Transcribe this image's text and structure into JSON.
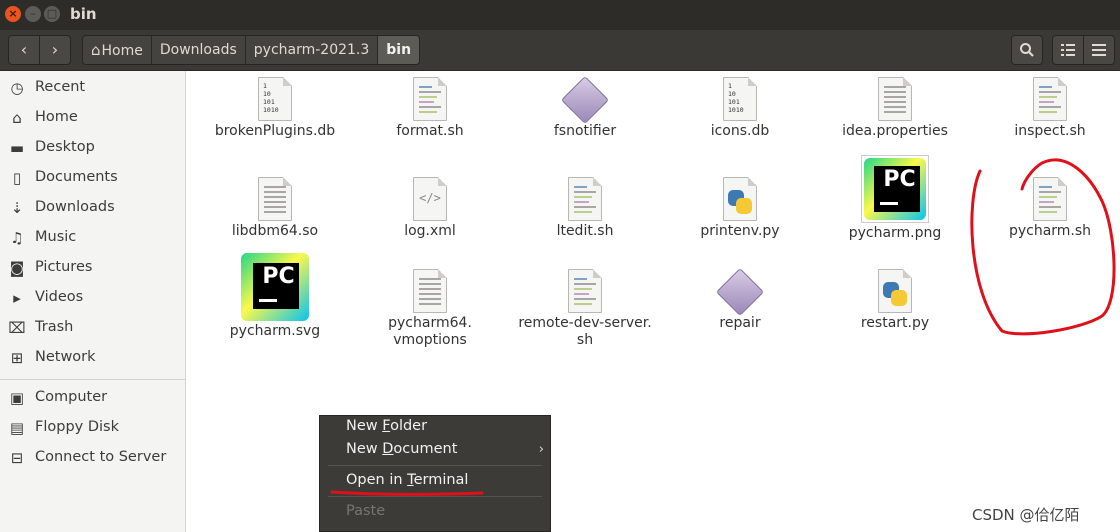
{
  "window": {
    "title": "bin"
  },
  "toolbar": {
    "crumbs": [
      "Home",
      "Downloads",
      "pycharm-2021.3",
      "bin"
    ]
  },
  "sidebar": {
    "items": [
      {
        "label": "Recent",
        "icon": "clock-icon"
      },
      {
        "label": "Home",
        "icon": "home-icon"
      },
      {
        "label": "Desktop",
        "icon": "folder-icon"
      },
      {
        "label": "Documents",
        "icon": "document-icon"
      },
      {
        "label": "Downloads",
        "icon": "download-icon"
      },
      {
        "label": "Music",
        "icon": "music-icon"
      },
      {
        "label": "Pictures",
        "icon": "camera-icon"
      },
      {
        "label": "Videos",
        "icon": "video-icon"
      },
      {
        "label": "Trash",
        "icon": "trash-icon"
      },
      {
        "label": "Network",
        "icon": "network-icon"
      }
    ],
    "devices": [
      {
        "label": "Computer",
        "icon": "computer-icon"
      },
      {
        "label": "Floppy Disk",
        "icon": "floppy-icon"
      },
      {
        "label": "Connect to Server",
        "icon": "server-icon"
      }
    ]
  },
  "files": [
    {
      "name": "brokenPlugins.db",
      "icon": "binary-file-icon"
    },
    {
      "name": "format.sh",
      "icon": "script-file-icon"
    },
    {
      "name": "fsnotifier",
      "icon": "executable-icon"
    },
    {
      "name": "icons.db",
      "icon": "binary-file-icon"
    },
    {
      "name": "idea.properties",
      "icon": "text-file-icon"
    },
    {
      "name": "inspect.sh",
      "icon": "script-file-icon"
    },
    {
      "name": "libdbm64.so",
      "icon": "text-file-icon"
    },
    {
      "name": "log.xml",
      "icon": "xml-file-icon"
    },
    {
      "name": "ltedit.sh",
      "icon": "script-file-icon"
    },
    {
      "name": "printenv.py",
      "icon": "python-file-icon"
    },
    {
      "name": "pycharm.png",
      "icon": "pycharm-logo-icon"
    },
    {
      "name": "pycharm.sh",
      "icon": "script-file-icon"
    },
    {
      "name": "pycharm.svg",
      "icon": "pycharm-logo-icon"
    },
    {
      "name": "pycharm64.",
      "name2": "vmoptions",
      "icon": "text-file-icon"
    },
    {
      "name": "remote-dev-server.",
      "name2": "sh",
      "icon": "script-file-icon"
    },
    {
      "name": "repair",
      "icon": "executable-icon"
    },
    {
      "name": "restart.py",
      "icon": "python-file-icon"
    }
  ],
  "context_menu": {
    "items": [
      {
        "pre": "New ",
        "ul": "F",
        "post": "older"
      },
      {
        "pre": "New ",
        "ul": "D",
        "post": "ocument"
      },
      {
        "pre": "Open in ",
        "ul": "T",
        "post": "erminal"
      },
      {
        "pre": "Paste",
        "ul": "",
        "post": ""
      }
    ]
  },
  "icons": {
    "pc_text": "PC",
    "binary_text": [
      "1",
      "10",
      "101",
      "1010"
    ],
    "xml_glyph": "</>"
  },
  "watermark": "CSDN @佮亿陌",
  "colors": {
    "title_bar": "#2d2c29",
    "toolbar": "#3a3935",
    "close_button": "#e95420",
    "menu_bg": "#3c3b37",
    "annotation_red": "#e0101a"
  }
}
